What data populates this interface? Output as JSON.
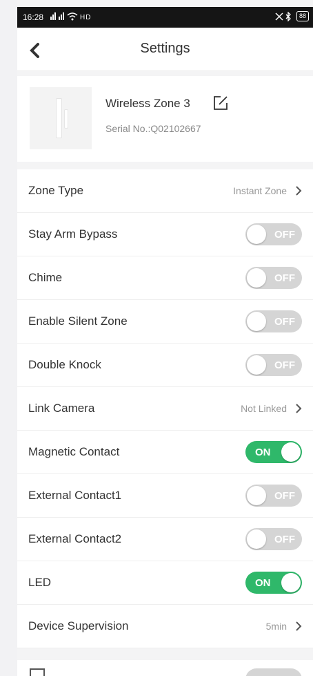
{
  "status_bar": {
    "time": "16:28",
    "signal_text": "ᴴᴵ ᴴᴵ ≈ HD",
    "battery": "88"
  },
  "nav": {
    "title": "Settings"
  },
  "device": {
    "name": "Wireless Zone 3",
    "serial": "Serial No.:Q02102667"
  },
  "rows": [
    {
      "label": "Zone Type",
      "value": "Instant Zone",
      "kind": "link"
    },
    {
      "label": "Stay Arm Bypass",
      "state": "OFF",
      "kind": "toggle"
    },
    {
      "label": "Chime",
      "state": "OFF",
      "kind": "toggle"
    },
    {
      "label": "Enable Silent Zone",
      "state": "OFF",
      "kind": "toggle"
    },
    {
      "label": "Double Knock",
      "state": "OFF",
      "kind": "toggle"
    },
    {
      "label": "Link Camera",
      "value": "Not Linked",
      "kind": "link"
    },
    {
      "label": "Magnetic Contact",
      "state": "ON",
      "kind": "toggle"
    },
    {
      "label": "External Contact1",
      "state": "OFF",
      "kind": "toggle"
    },
    {
      "label": "External Contact2",
      "state": "OFF",
      "kind": "toggle"
    },
    {
      "label": "LED",
      "state": "ON",
      "kind": "toggle"
    },
    {
      "label": "Device Supervision",
      "value": "5min",
      "kind": "link"
    }
  ],
  "colors": {
    "toggle_on": "#2fb86a",
    "toggle_off": "#d5d5d5"
  }
}
